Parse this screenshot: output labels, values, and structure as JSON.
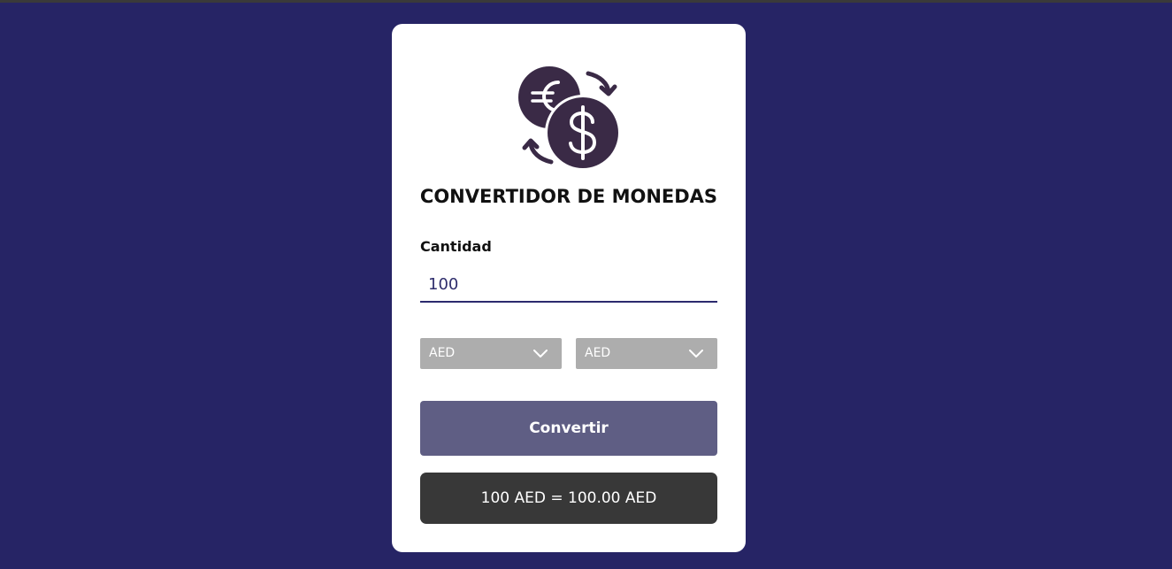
{
  "app": {
    "title": "CONVERTIDOR DE MONEDAS",
    "logo_icon": "currency-exchange-icon"
  },
  "amount": {
    "label": "Cantidad",
    "value": "100"
  },
  "from_currency": {
    "selected": "AED",
    "icon": "chevron-down-icon"
  },
  "to_currency": {
    "selected": "AED",
    "icon": "chevron-down-icon"
  },
  "convert_button": {
    "label": "Convertir"
  },
  "result": {
    "text": "100 AED = 100.00 AED"
  },
  "colors": {
    "background": "#262465",
    "card": "#ffffff",
    "icon": "#3a2a46",
    "button": "#5f5e84",
    "select": "#adadad",
    "result": "#383838"
  }
}
